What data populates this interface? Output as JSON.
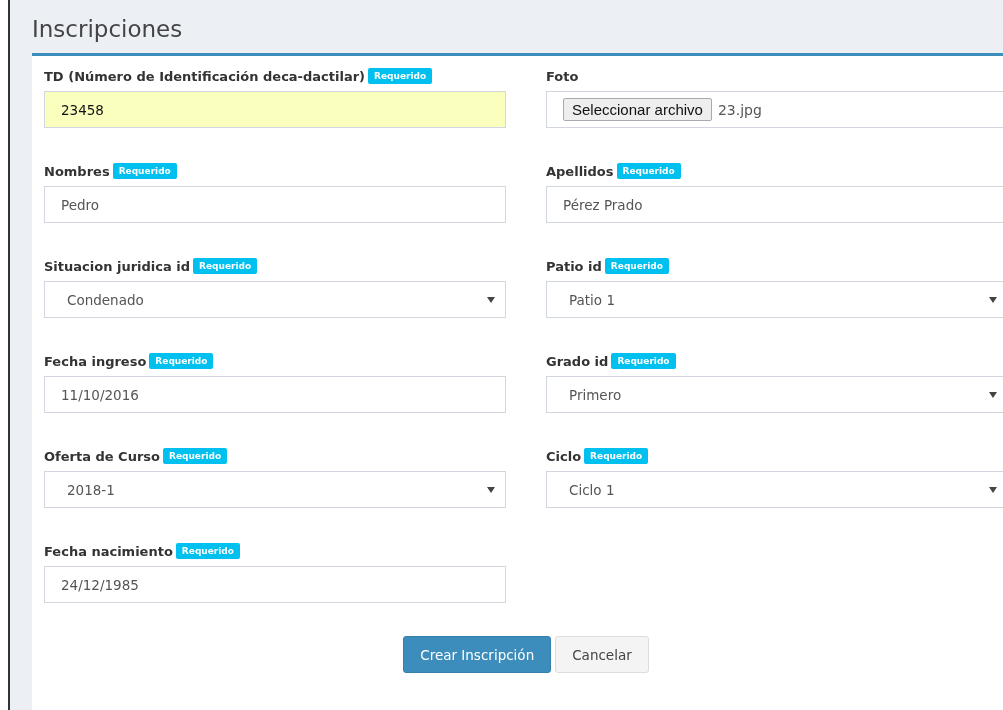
{
  "page_title": "Inscripciones",
  "fields": [
    {
      "kind": "text",
      "label": "TD (Número de Identificación deca-dactilar)",
      "badge": "Requerido",
      "value": "23458",
      "autofilled": true
    },
    {
      "kind": "file",
      "label": "Foto",
      "button": "Seleccionar archivo",
      "value": "23.jpg"
    },
    {
      "kind": "text",
      "label": "Nombres",
      "badge": "Requerido",
      "value": "Pedro",
      "autofilled": false
    },
    {
      "kind": "text",
      "label": "Apellidos",
      "badge": "Requerido",
      "value": "Pérez Prado",
      "autofilled": false
    },
    {
      "kind": "select",
      "label": "Situacion juridica id",
      "badge": "Requerido",
      "value": "Condenado"
    },
    {
      "kind": "select",
      "label": "Patio id",
      "badge": "Requerido",
      "value": "Patio 1"
    },
    {
      "kind": "text",
      "label": "Fecha ingreso",
      "badge": "Requerido",
      "value": "11/10/2016",
      "autofilled": false
    },
    {
      "kind": "select",
      "label": "Grado id",
      "badge": "Requerido",
      "value": "Primero"
    },
    {
      "kind": "select",
      "label": "Oferta de Curso",
      "badge": "Requerido",
      "value": "2018-1"
    },
    {
      "kind": "select",
      "label": "Ciclo",
      "badge": "Requerido",
      "value": "Ciclo 1"
    },
    {
      "kind": "text",
      "label": "Fecha nacimiento",
      "badge": "Requerido",
      "value": "24/12/1985",
      "autofilled": false
    }
  ],
  "buttons": [
    {
      "kind": "primary",
      "label": "Crear Inscripción"
    },
    {
      "kind": "default",
      "label": "Cancelar"
    }
  ]
}
